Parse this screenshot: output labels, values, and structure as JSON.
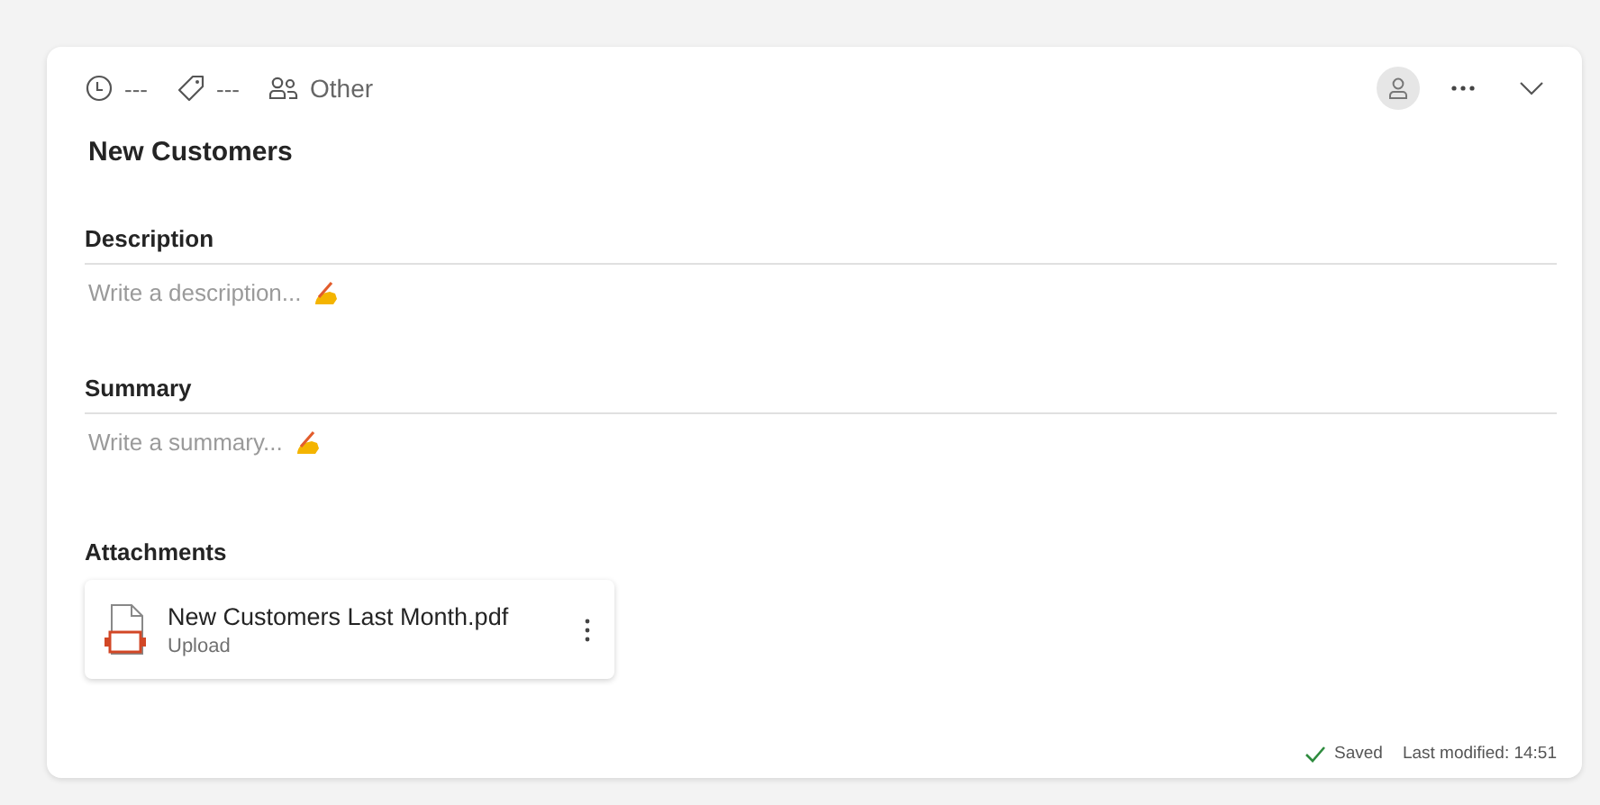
{
  "header": {
    "time": "---",
    "tags": "---",
    "audience": "Other"
  },
  "title": "New Customers",
  "sections": [
    {
      "label": "Description",
      "placeholder": "Write a description..."
    },
    {
      "label": "Summary",
      "placeholder": "Write a summary..."
    }
  ],
  "attachments": {
    "label": "Attachments",
    "files": [
      {
        "name": "New Customers Last Month.pdf",
        "status": "Upload"
      }
    ]
  },
  "footer": {
    "status": "Saved",
    "modified": "Last modified: 14:51"
  }
}
